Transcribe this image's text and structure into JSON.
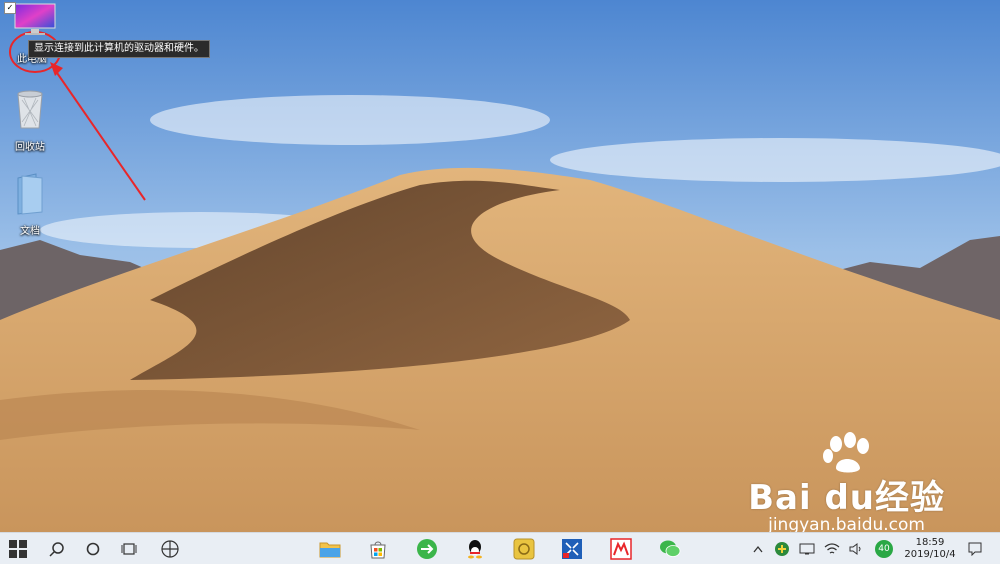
{
  "desktop": {
    "icons": [
      {
        "label": "此电脑"
      },
      {
        "label": "回收站"
      },
      {
        "label": "文档"
      }
    ],
    "tooltip": "显示连接到此计算机的驱动器和硬件。"
  },
  "watermark": {
    "brand": "Bai du经验",
    "url": "jingyan.baidu.com"
  },
  "taskbar": {
    "apps": [
      "start-button",
      "search-icon",
      "cortana-icon",
      "task-view-icon",
      "pinwheel-app-icon",
      "file-explorer-icon",
      "store-icon",
      "browser-icon",
      "qq-icon",
      "app-icon",
      "tools-icon",
      "app-red-icon",
      "wechat-icon"
    ],
    "tray": {
      "badge": "40",
      "time": "18:59",
      "date": "2019/10/4"
    }
  },
  "colors": {
    "sky_top": "#5b8fd6",
    "sand": "#d7a66a",
    "taskbar": "#e9eef4",
    "annotation_red": "#e8262a"
  }
}
